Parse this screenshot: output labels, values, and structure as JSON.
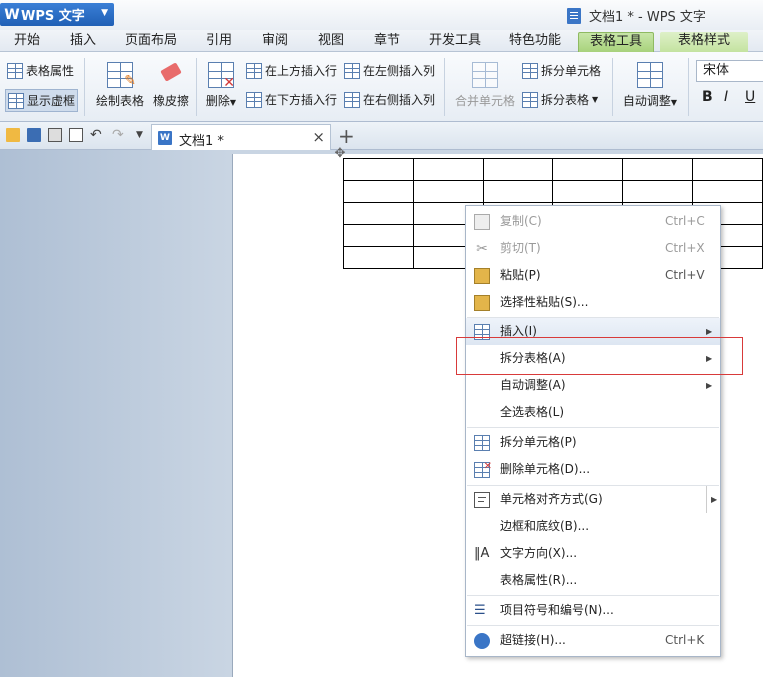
{
  "app": {
    "name": "WPS 文字",
    "logo_letter": "W",
    "window_title": "文档1 * - WPS 文字"
  },
  "tabs": [
    "开始",
    "插入",
    "页面布局",
    "引用",
    "审阅",
    "视图",
    "章节",
    "开发工具",
    "特色功能",
    "表格工具",
    "表格样式"
  ],
  "active_tab": "表格工具",
  "ribbon": {
    "table_props": "表格属性",
    "show_gridlines": "显示虚框",
    "draw_table": "绘制表格",
    "eraser": "橡皮擦",
    "delete": "删除",
    "insert_row_above": "在上方插入行",
    "insert_row_below": "在下方插入行",
    "insert_col_left": "在左侧插入列",
    "insert_col_right": "在右侧插入列",
    "merge_cells": "合并单元格",
    "split_cells": "拆分单元格",
    "split_table": "拆分表格",
    "auto_fit": "自动调整",
    "font_name": "宋体",
    "bold": "B",
    "italic": "I",
    "underline": "U"
  },
  "document_tab": {
    "label": "文档1 *",
    "close": "×",
    "new": "+",
    "icon_text": "W"
  },
  "context_menu": {
    "items": [
      {
        "label": "复制(C)",
        "shortcut": "Ctrl+C",
        "disabled": true,
        "icon": "copy-icon"
      },
      {
        "label": "剪切(T)",
        "shortcut": "Ctrl+X",
        "disabled": true,
        "icon": "cut-icon"
      },
      {
        "label": "粘贴(P)",
        "shortcut": "Ctrl+V",
        "icon": "paste-icon"
      },
      {
        "label": "选择性粘贴(S)...",
        "icon": "paste-special-icon"
      },
      {
        "label": "插入(I)",
        "submenu": true,
        "highlighted": true,
        "icon": "table-insert-icon"
      },
      {
        "label": "拆分表格(A)",
        "submenu": true
      },
      {
        "label": "自动调整(A)",
        "submenu": true
      },
      {
        "label": "全选表格(L)"
      },
      {
        "label": "拆分单元格(P)",
        "icon": "split-cells-icon"
      },
      {
        "label": "删除单元格(D)...",
        "icon": "delete-cells-icon"
      },
      {
        "label": "单元格对齐方式(G)",
        "submenu": true,
        "icon": "cell-align-icon"
      },
      {
        "label": "边框和底纹(B)..."
      },
      {
        "label": "文字方向(X)...",
        "icon": "text-direction-icon"
      },
      {
        "label": "表格属性(R)..."
      },
      {
        "label": "项目符号和编号(N)...",
        "icon": "bullets-icon"
      },
      {
        "label": "超链接(H)...",
        "shortcut": "Ctrl+K",
        "icon": "hyperlink-icon"
      }
    ],
    "highlight_box_color": "#d83a3a"
  },
  "colors": {
    "brand_blue": "#2a6cc6",
    "active_tab_green": "#a8d27c",
    "highlight_red": "#d83a3a"
  }
}
